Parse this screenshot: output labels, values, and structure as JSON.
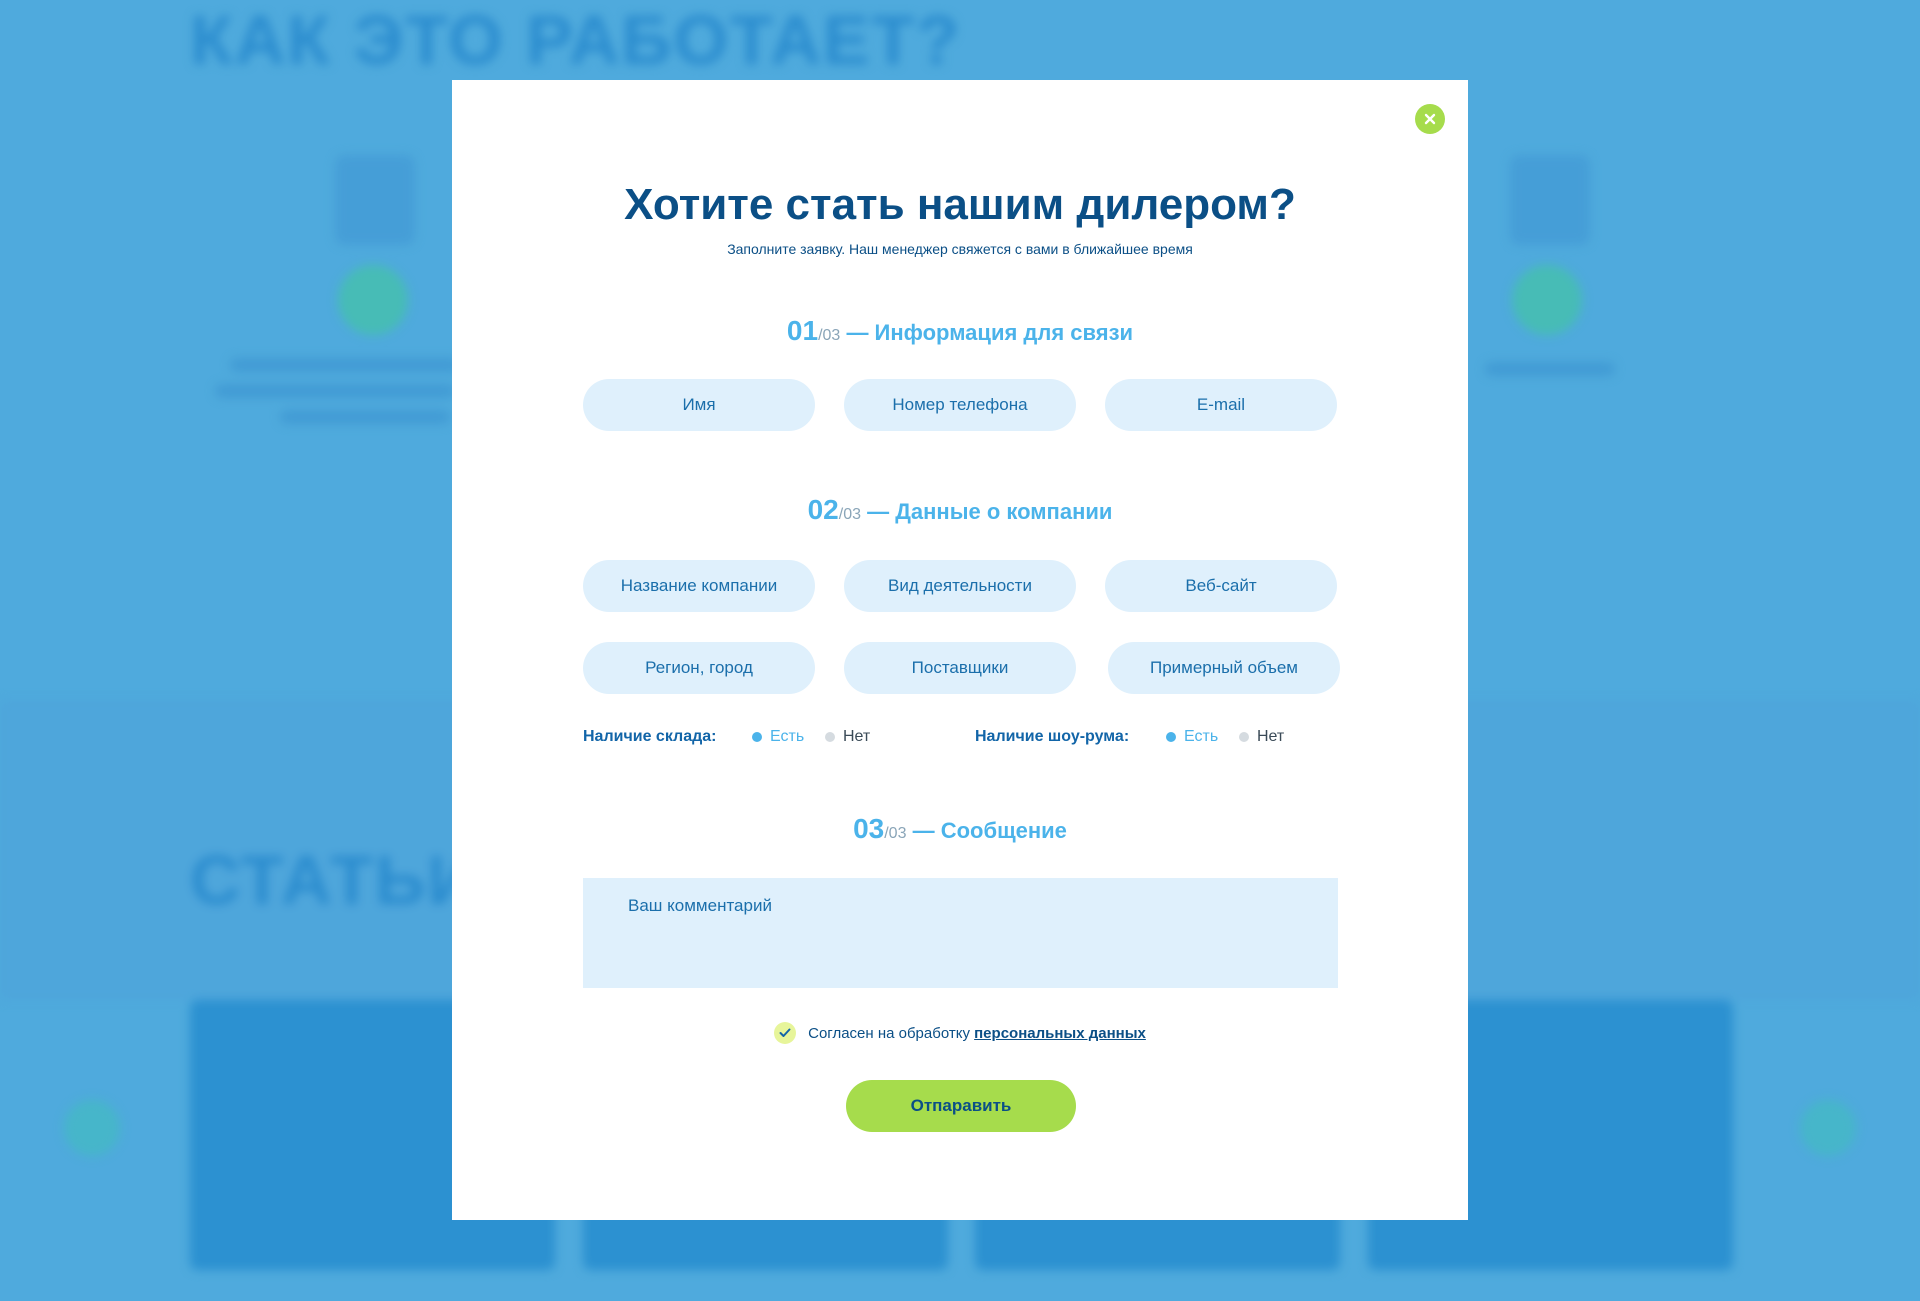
{
  "background": {
    "heading_top": "КАК ЭТО РАБОТАЕТ?",
    "heading_bottom": "СТАТЬИ И"
  },
  "modal": {
    "title": "Хотите стать нашим дилером?",
    "subtitle": "Заполните заявку. Наш менеджер свяжется с вами в ближайшее время",
    "close_icon": "close-icon",
    "sections": [
      {
        "num": "01",
        "total": "/03",
        "title": " — Информация для связи"
      },
      {
        "num": "02",
        "total": "/03",
        "title": " — Данные о компании"
      },
      {
        "num": "03",
        "total": "/03",
        "title": " — Сообщение"
      }
    ],
    "contact_fields": {
      "name": "Имя",
      "phone": "Номер телефона",
      "email": "E-mail"
    },
    "company_fields": {
      "company_name": "Название компании",
      "activity": "Вид деятельности",
      "website": "Веб-сайт",
      "region": "Регион, город",
      "suppliers": "Поставщики",
      "volume": "Примерный объем"
    },
    "warehouse": {
      "label": "Наличие склада:",
      "yes": "Есть",
      "no": "Нет",
      "selected": "yes"
    },
    "showroom": {
      "label": "Наличие шоу-рума:",
      "yes": "Есть",
      "no": "Нет",
      "selected": "yes"
    },
    "comment_placeholder": "Ваш комментарий",
    "consent": {
      "text": "Согласен на обработку",
      "link": "персональных данных",
      "checked": true
    },
    "submit_label": "Отпаравить"
  },
  "colors": {
    "background": "#4faadc",
    "title": "#0b4f86",
    "accent": "#4bb3ea",
    "field": "#dff0fc",
    "button": "#a6dc4c"
  }
}
